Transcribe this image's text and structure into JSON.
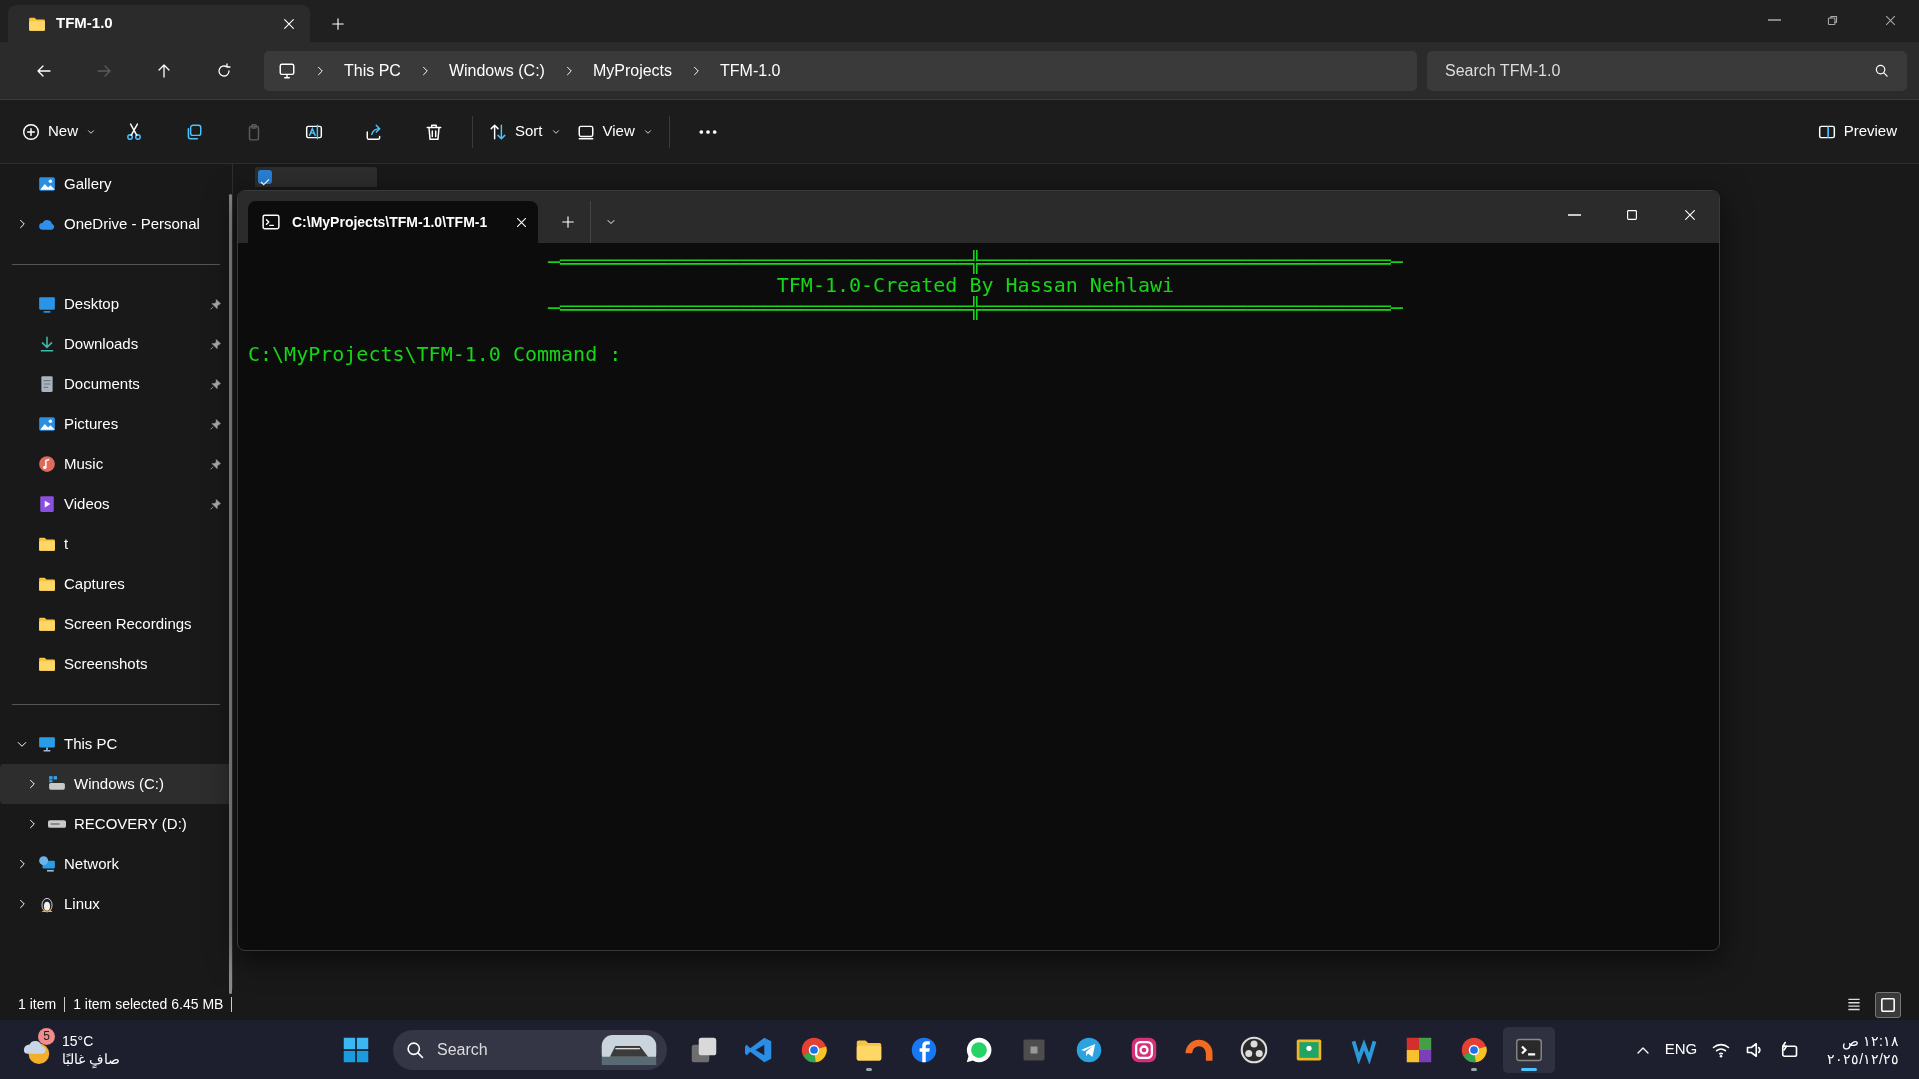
{
  "explorer": {
    "tab": {
      "title": "TFM-1.0"
    },
    "nav": [
      {
        "kind": "back",
        "disabled": false
      },
      {
        "kind": "forward",
        "disabled": true
      },
      {
        "kind": "up",
        "disabled": false
      },
      {
        "kind": "refresh",
        "disabled": false
      }
    ],
    "breadcrumb": [
      "This PC",
      "Windows (C:)",
      "MyProjects",
      "TFM-1.0"
    ],
    "search": {
      "placeholder": "Search TFM-1.0"
    },
    "toolbar": [
      {
        "kind": "new",
        "label": "New",
        "disabled": false
      },
      {
        "kind": "cut",
        "disabled": false
      },
      {
        "kind": "copy",
        "disabled": false
      },
      {
        "kind": "paste",
        "disabled": true
      },
      {
        "kind": "rename",
        "disabled": false
      },
      {
        "kind": "share",
        "disabled": false
      },
      {
        "kind": "delete",
        "disabled": false
      },
      {
        "kind": "separator"
      },
      {
        "kind": "sort",
        "label": "Sort",
        "disabled": false
      },
      {
        "kind": "view",
        "label": "View",
        "disabled": false
      },
      {
        "kind": "separator"
      },
      {
        "kind": "more",
        "disabled": false
      }
    ],
    "preview": {
      "label": "Preview"
    },
    "sidebar": {
      "groups": [
        {
          "items": [
            {
              "label": "Gallery",
              "kind": "gallery",
              "selected": false
            },
            {
              "label": "OneDrive - Personal",
              "kind": "cloud",
              "expanded": false,
              "selected": false
            }
          ]
        },
        {
          "items": [
            {
              "label": "Desktop",
              "kind": "desktop",
              "pinned": true,
              "selected": false
            },
            {
              "label": "Downloads",
              "kind": "download",
              "pinned": true,
              "selected": false
            },
            {
              "label": "Documents",
              "kind": "document",
              "pinned": true,
              "selected": false
            },
            {
              "label": "Pictures",
              "kind": "gallery",
              "pinned": true,
              "selected": false
            },
            {
              "label": "Music",
              "kind": "music",
              "pinned": true,
              "selected": false
            },
            {
              "label": "Videos",
              "kind": "video",
              "pinned": true,
              "selected": false
            },
            {
              "label": "t",
              "kind": "folder",
              "pinned": false,
              "selected": false
            },
            {
              "label": "Captures",
              "kind": "folder",
              "pinned": false,
              "selected": false
            },
            {
              "label": "Screen Recordings",
              "kind": "folder",
              "pinned": false,
              "selected": false
            },
            {
              "label": "Screenshots",
              "kind": "folder",
              "pinned": false,
              "selected": false
            }
          ]
        },
        {
          "items": [
            {
              "label": "This PC",
              "kind": "pc",
              "expanded": true,
              "selected": false,
              "children": [
                {
                  "label": "Windows (C:)",
                  "kind": "drive-win",
                  "expanded": false,
                  "selected": true
                },
                {
                  "label": "RECOVERY (D:)",
                  "kind": "drive",
                  "expanded": false,
                  "selected": false
                }
              ]
            },
            {
              "label": "Network",
              "kind": "network",
              "expanded": false,
              "selected": false
            },
            {
              "label": "Linux",
              "kind": "penguin",
              "expanded": false,
              "selected": false
            }
          ]
        }
      ]
    },
    "files": [
      {
        "checked": true
      }
    ],
    "status_bar": {
      "count": "1 item",
      "selection": "1 item selected",
      "size": "6.45 MB"
    },
    "views": [
      {
        "kind": "details",
        "selected": false
      },
      {
        "kind": "tiles",
        "selected": true
      }
    ]
  },
  "terminal": {
    "tab": {
      "title": "C:\\MyProjects\\TFM-1.0\\TFM-1"
    },
    "lines": [
      {
        "kind": "rule",
        "text": "─══════════════════════════════════╬══════════════════════════════════─"
      },
      {
        "kind": "title",
        "text": "TFM-1.0-Created By Hassan Nehlawi"
      },
      {
        "kind": "rule",
        "text": "─══════════════════════════════════╬══════════════════════════════════─"
      },
      {
        "kind": "prompt",
        "text": "C:\\MyProjects\\TFM-1.0 Command :"
      }
    ]
  },
  "taskbar": {
    "weather": {
      "badge": "5",
      "temperature": "15°C",
      "condition": "صافٍ غالبًا"
    },
    "search": {
      "placeholder": "Search"
    },
    "apps": [
      {
        "kind": "task-view",
        "running": false,
        "selected": false
      },
      {
        "kind": "code",
        "running": false,
        "selected": false
      },
      {
        "kind": "browser",
        "running": false,
        "selected": false
      },
      {
        "kind": "folder",
        "running": true,
        "selected": false
      },
      {
        "kind": "social",
        "running": false,
        "selected": false
      },
      {
        "kind": "chat",
        "running": false,
        "selected": false
      },
      {
        "kind": "square",
        "running": false,
        "selected": false
      },
      {
        "kind": "plane",
        "running": false,
        "selected": false
      },
      {
        "kind": "camera",
        "running": false,
        "selected": false
      },
      {
        "kind": "arc",
        "running": false,
        "selected": false
      },
      {
        "kind": "aperture",
        "running": false,
        "selected": false
      },
      {
        "kind": "board",
        "running": false,
        "selected": false
      },
      {
        "kind": "wave",
        "running": false,
        "selected": false
      },
      {
        "kind": "tiles",
        "running": false,
        "selected": false
      },
      {
        "kind": "browser",
        "running": true,
        "selected": false
      },
      {
        "kind": "terminal",
        "running": true,
        "selected": true
      }
    ],
    "language": "ENG",
    "time": "١٢:١٨ ص",
    "date": "٢٠٢٥/١٢/٢٥"
  }
}
